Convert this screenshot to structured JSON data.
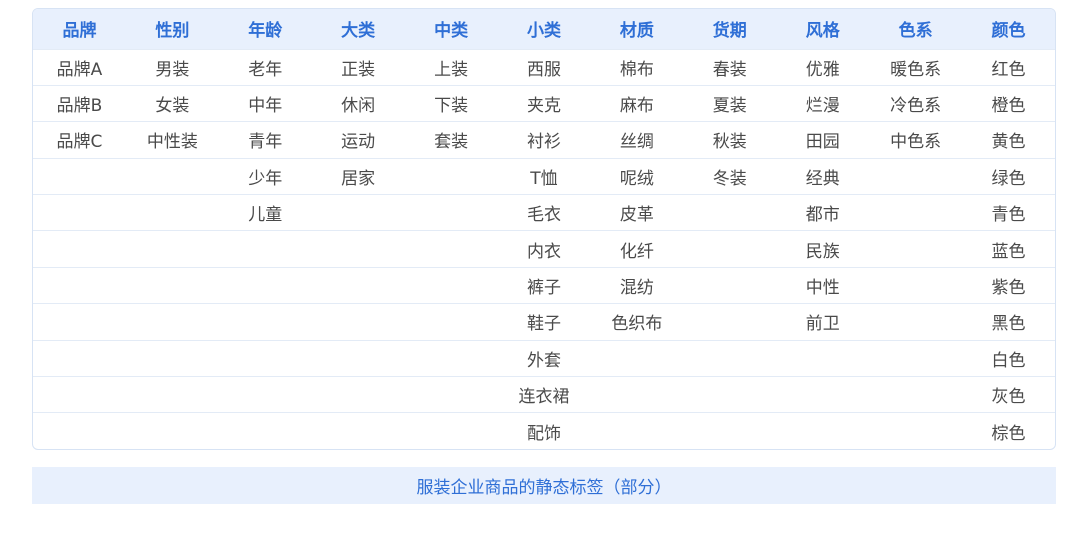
{
  "table": {
    "headers": [
      "品牌",
      "性别",
      "年龄",
      "大类",
      "中类",
      "小类",
      "材质",
      "货期",
      "风格",
      "色系",
      "颜色"
    ],
    "rows": [
      [
        "品牌A",
        "男装",
        "老年",
        "正装",
        "上装",
        "西服",
        "棉布",
        "春装",
        "优雅",
        "暖色系",
        "红色"
      ],
      [
        "品牌B",
        "女装",
        "中年",
        "休闲",
        "下装",
        "夹克",
        "麻布",
        "夏装",
        "烂漫",
        "冷色系",
        "橙色"
      ],
      [
        "品牌C",
        "中性装",
        "青年",
        "运动",
        "套装",
        "衬衫",
        "丝绸",
        "秋装",
        "田园",
        "中色系",
        "黄色"
      ],
      [
        "",
        "",
        "少年",
        "居家",
        "",
        "T恤",
        "呢绒",
        "冬装",
        "经典",
        "",
        "绿色"
      ],
      [
        "",
        "",
        "儿童",
        "",
        "",
        "毛衣",
        "皮革",
        "",
        "都市",
        "",
        "青色"
      ],
      [
        "",
        "",
        "",
        "",
        "",
        "内衣",
        "化纤",
        "",
        "民族",
        "",
        "蓝色"
      ],
      [
        "",
        "",
        "",
        "",
        "",
        "裤子",
        "混纺",
        "",
        "中性",
        "",
        "紫色"
      ],
      [
        "",
        "",
        "",
        "",
        "",
        "鞋子",
        "色织布",
        "",
        "前卫",
        "",
        "黑色"
      ],
      [
        "",
        "",
        "",
        "",
        "",
        "外套",
        "",
        "",
        "",
        "",
        "白色"
      ],
      [
        "",
        "",
        "",
        "",
        "",
        "连衣裙",
        "",
        "",
        "",
        "",
        "灰色"
      ],
      [
        "",
        "",
        "",
        "",
        "",
        "配饰",
        "",
        "",
        "",
        "",
        "棕色"
      ]
    ]
  },
  "caption": "服装企业商品的静态标签（部分）",
  "colors": {
    "header_text": "#2f6fd6",
    "header_bg": "#e8f0fd",
    "cell_text": "#4a4a4a",
    "border": "#d7e3f4"
  }
}
